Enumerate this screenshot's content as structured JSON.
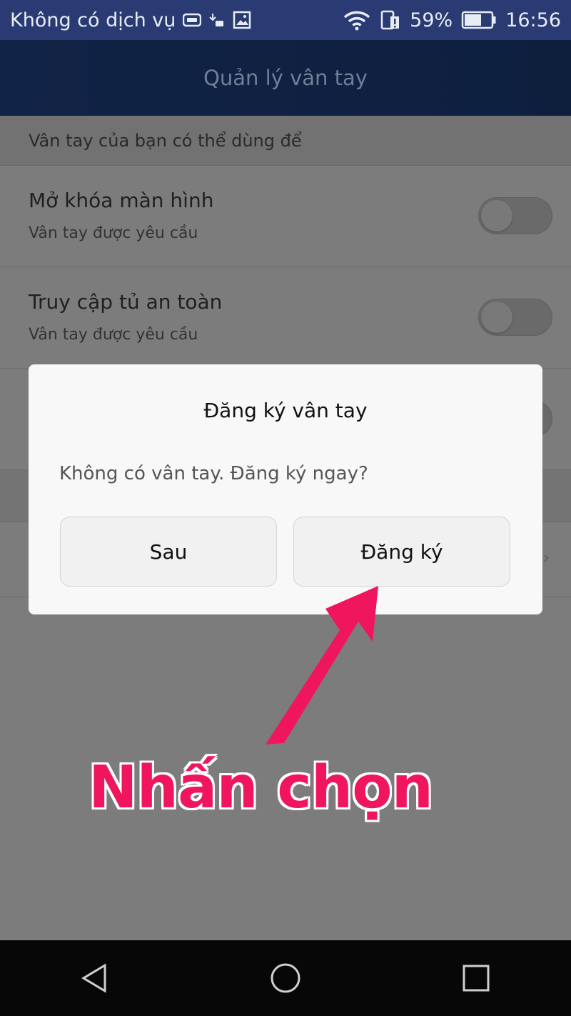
{
  "status_bar": {
    "carrier": "Không có dịch vụ",
    "battery_percent": "59%",
    "time": "16:56",
    "icons": [
      "sim-icon",
      "download-icon",
      "image-icon",
      "wifi-icon",
      "storage-alert-icon",
      "battery-icon"
    ]
  },
  "app_bar": {
    "title": "Quản lý vân tay"
  },
  "section": {
    "header": "Vân tay của bạn có thể dùng để"
  },
  "settings": [
    {
      "title": "Mở khóa màn hình",
      "subtitle": "Vân tay được yêu cầu",
      "enabled": false
    },
    {
      "title": "Truy cập tủ an toàn",
      "subtitle": "Vân tay được yêu cầu",
      "enabled": false
    }
  ],
  "dialog": {
    "title": "Đăng ký vân tay",
    "message": "Không có vân tay. Đăng ký ngay?",
    "later_label": "Sau",
    "register_label": "Đăng ký"
  },
  "annotation": {
    "text": "Nhấn chọn",
    "color": "#f0165e"
  },
  "nav_bar": {
    "icons": [
      "back-icon",
      "home-icon",
      "recents-icon"
    ]
  }
}
